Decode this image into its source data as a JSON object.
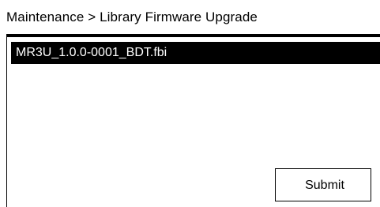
{
  "header": {
    "breadcrumb": "Maintenance > Library Firmware Upgrade"
  },
  "file_list": {
    "items": [
      {
        "label": "MR3U_1.0.0-0001_BDT.fbi",
        "selected": true
      }
    ]
  },
  "actions": {
    "submit_label": "Submit"
  },
  "colors": {
    "background": "#ffffff",
    "foreground": "#000000",
    "selection_background": "#000000",
    "selection_text": "#ffffff"
  }
}
